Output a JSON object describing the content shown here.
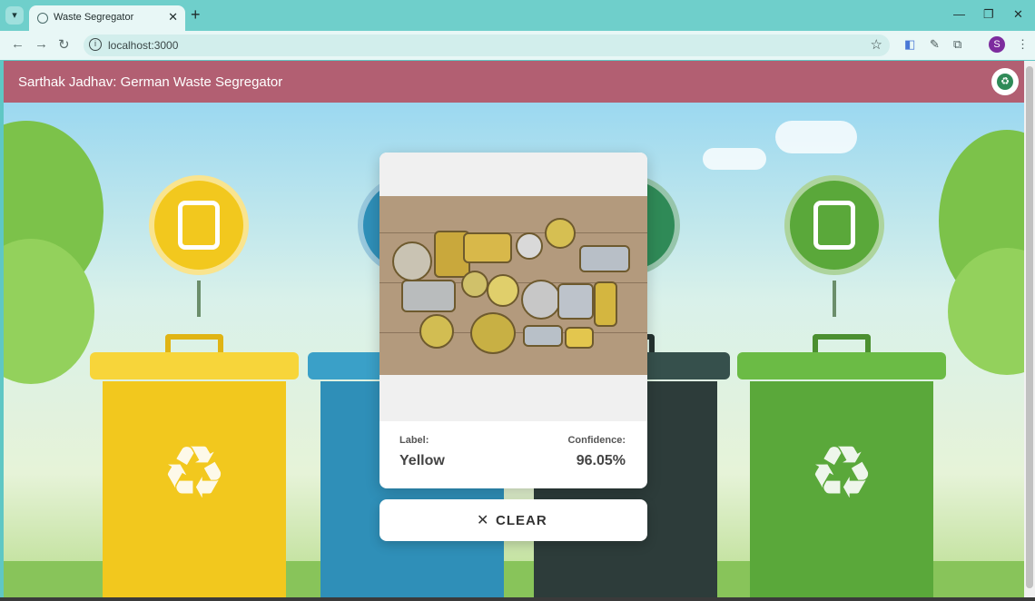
{
  "browser": {
    "tab_title": "Waste Segregator",
    "url": "localhost:3000",
    "profile_initial": "S"
  },
  "app": {
    "title": "Sarthak Jadhav: German Waste Segregator"
  },
  "result": {
    "label_caption": "Label:",
    "label_value": "Yellow",
    "confidence_caption": "Confidence:",
    "confidence_value": "96.05%"
  },
  "clear_button": {
    "label": "CLEAR"
  },
  "colors": {
    "header": "#b25f72",
    "bin_yellow": "#f2c81e",
    "bin_blue": "#2f8fb8",
    "bin_black": "#2d3c3a",
    "bin_green": "#5aa83a"
  }
}
